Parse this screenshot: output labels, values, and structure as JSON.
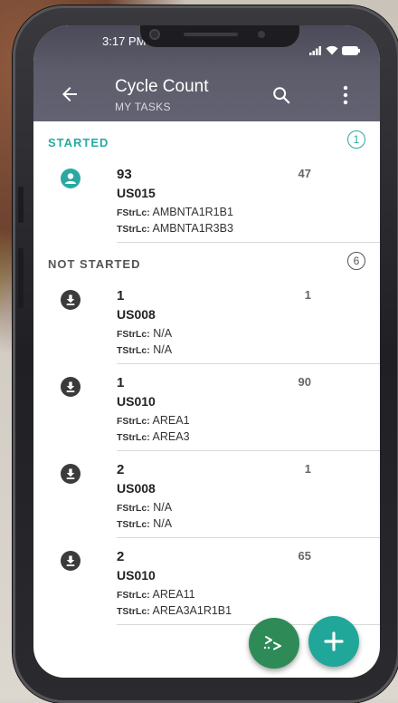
{
  "status_bar": {
    "time": "3:17 PM"
  },
  "app_bar": {
    "title": "Cycle Count",
    "subtitle": "MY TASKS"
  },
  "labels": {
    "from": "FStrLc:",
    "to": "TStrLc:"
  },
  "sections": [
    {
      "title": "STARTED",
      "count": "1",
      "color": "#2aa9a3",
      "items": [
        {
          "qty": "93",
          "code": "US015",
          "from": "AMBNTA1R1B1",
          "to": "AMBNTA1R3B3",
          "num": "47",
          "icon": "person-icon"
        }
      ]
    },
    {
      "title": "NOT STARTED",
      "count": "6",
      "color": "#555555",
      "items": [
        {
          "qty": "1",
          "code": "US008",
          "from": "N/A",
          "to": "N/A",
          "num": "1",
          "icon": "download-icon"
        },
        {
          "qty": "1",
          "code": "US010",
          "from": "AREA1",
          "to": "AREA3",
          "num": "90",
          "icon": "download-icon"
        },
        {
          "qty": "2",
          "code": "US008",
          "from": "N/A",
          "to": "N/A",
          "num": "1",
          "icon": "download-icon"
        },
        {
          "qty": "2",
          "code": "US010",
          "from": "AREA11",
          "to": "AREA3A1R1B1",
          "num": "65",
          "icon": "download-icon"
        }
      ]
    }
  ],
  "colors": {
    "accent": "#2aa9a3",
    "fab_send": "#2e8b57",
    "fab_add": "#21a79a",
    "appbar": "#5f5e6d"
  }
}
